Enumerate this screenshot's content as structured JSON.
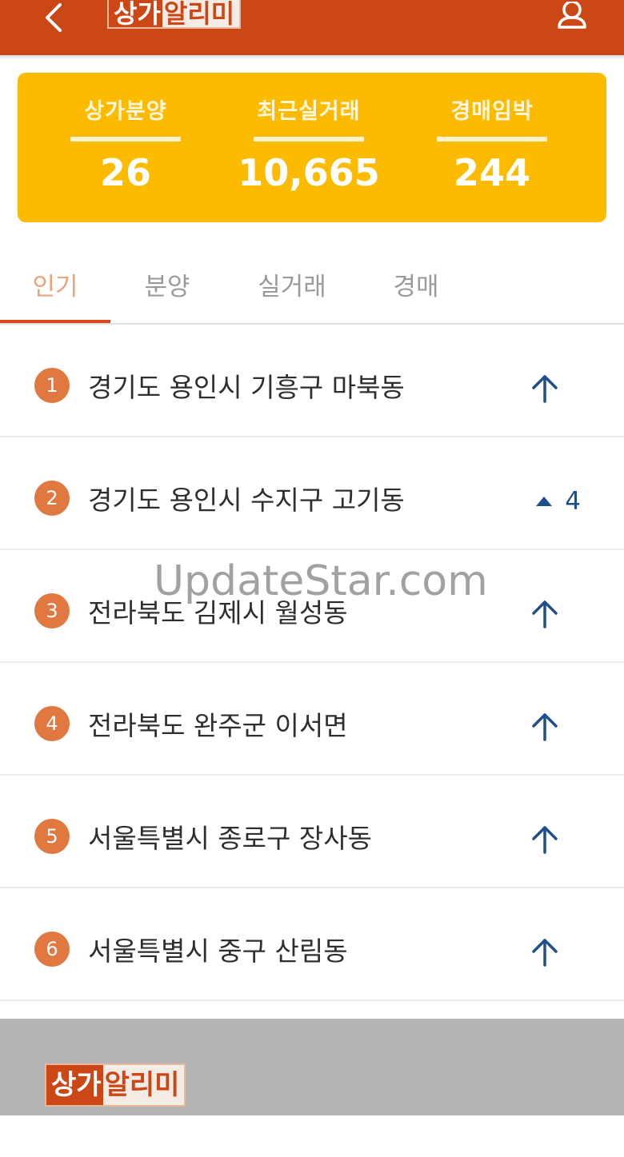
{
  "app": {
    "logo_part1": "상가",
    "logo_part2": "알리미"
  },
  "header": {
    "back_icon": "chevron-left-icon",
    "user_icon": "user-icon"
  },
  "stats": [
    {
      "label": "상가분양",
      "value": "26"
    },
    {
      "label": "최근실거래",
      "value": "10,665"
    },
    {
      "label": "경매임박",
      "value": "244"
    }
  ],
  "tabs": [
    {
      "label": "인기",
      "active": true
    },
    {
      "label": "분양",
      "active": false
    },
    {
      "label": "실거래",
      "active": false
    },
    {
      "label": "경매",
      "active": false
    }
  ],
  "ranking": [
    {
      "rank": "1",
      "region": "경기도 용인시 기흥구 마북동",
      "trend": "up-arrow"
    },
    {
      "rank": "2",
      "region": "경기도 용인시 수지구 고기동",
      "trend": "rise",
      "change": "4"
    },
    {
      "rank": "3",
      "region": "전라북도 김제시 월성동",
      "trend": "up-arrow"
    },
    {
      "rank": "4",
      "region": "전라북도 완주군 이서면",
      "trend": "up-arrow"
    },
    {
      "rank": "5",
      "region": "서울특별시 종로구 장사동",
      "trend": "up-arrow"
    },
    {
      "rank": "6",
      "region": "서울특별시 중구 산림동",
      "trend": "up-arrow"
    }
  ],
  "watermark": "UpdateStar.com",
  "colors": {
    "brand": "#cc4716",
    "card": "#fdbb00",
    "rank_badge": "#e0783f",
    "trend": "#1e4f8c",
    "tab_active": "#e8a37f"
  }
}
